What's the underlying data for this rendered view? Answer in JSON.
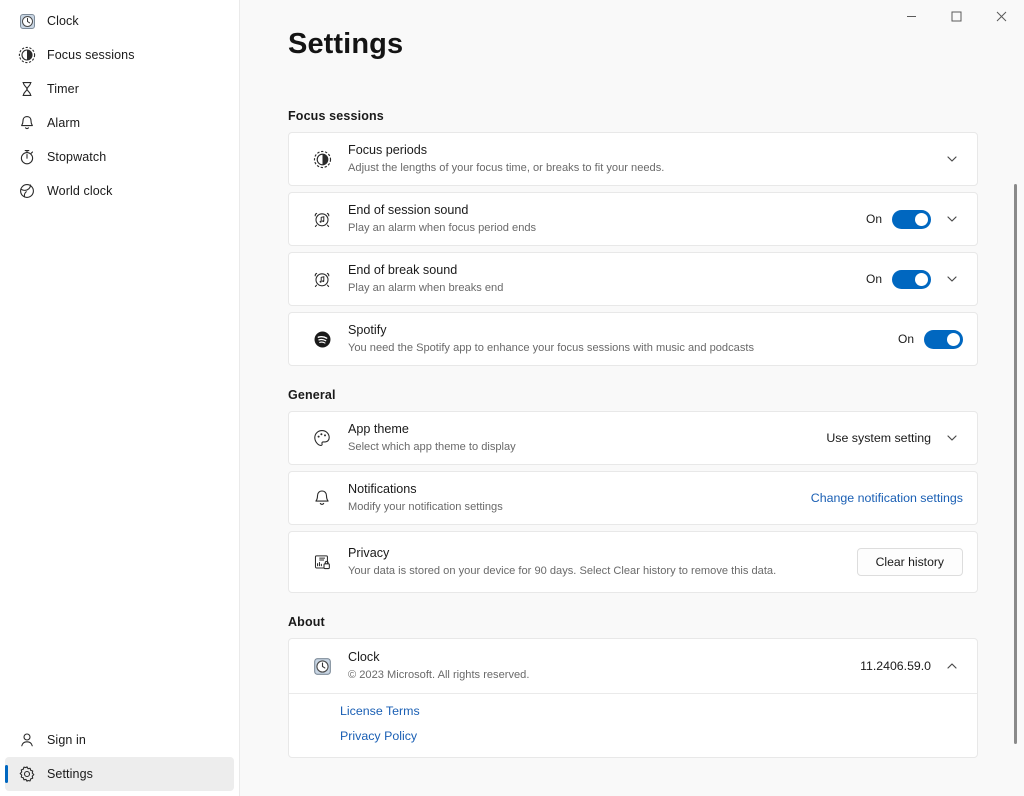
{
  "window": {
    "controls": [
      {
        "name": "minimize",
        "glyph": "minimize-icon"
      },
      {
        "name": "maximize",
        "glyph": "maximize-icon"
      },
      {
        "name": "close",
        "glyph": "close-icon"
      }
    ]
  },
  "sidebar": {
    "items": [
      {
        "label": "Clock",
        "icon": "clock-app-icon",
        "selected": false
      },
      {
        "label": "Focus sessions",
        "icon": "focus-sessions-icon",
        "selected": false
      },
      {
        "label": "Timer",
        "icon": "hourglass-icon",
        "selected": false
      },
      {
        "label": "Alarm",
        "icon": "bell-icon",
        "selected": false
      },
      {
        "label": "Stopwatch",
        "icon": "stopwatch-icon",
        "selected": false
      },
      {
        "label": "World clock",
        "icon": "globe-clock-icon",
        "selected": false
      }
    ],
    "bottom": [
      {
        "label": "Sign in",
        "icon": "person-icon",
        "selected": false
      },
      {
        "label": "Settings",
        "icon": "gear-icon",
        "selected": true
      }
    ]
  },
  "page": {
    "title": "Settings",
    "accent_color": "#0067C0",
    "link_color": "#1A5FB4"
  },
  "groups": {
    "focus_sessions": {
      "heading": "Focus sessions",
      "rows": [
        {
          "title": "Focus periods",
          "subtitle": "Adjust the lengths of your focus time, or breaks to fit your needs.",
          "icon": "focus-sessions-icon",
          "control": "chevron",
          "chevron": "down"
        },
        {
          "title": "End of session sound",
          "subtitle": "Play an alarm when focus period ends",
          "icon": "alarm-music-icon",
          "control": "toggle-chevron",
          "toggle_label": "On",
          "toggle_on": true,
          "chevron": "down"
        },
        {
          "title": "End of break sound",
          "subtitle": "Play an alarm when breaks end",
          "icon": "alarm-music-icon",
          "control": "toggle-chevron",
          "toggle_label": "On",
          "toggle_on": true,
          "chevron": "down"
        },
        {
          "title": "Spotify",
          "subtitle": "You need the Spotify app to enhance your focus sessions with music and podcasts",
          "icon": "spotify-icon",
          "control": "toggle",
          "toggle_label": "On",
          "toggle_on": true
        }
      ]
    },
    "general": {
      "heading": "General",
      "rows": [
        {
          "title": "App theme",
          "subtitle": "Select which app theme to display",
          "icon": "palette-icon",
          "control": "select",
          "value": "Use system setting",
          "chevron": "down"
        },
        {
          "title": "Notifications",
          "subtitle": "Modify your notification settings",
          "icon": "bell-icon",
          "control": "link",
          "link_text": "Change notification settings"
        },
        {
          "title": "Privacy",
          "subtitle": "Your data is stored on your device for 90 days. Select Clear history to remove this data.",
          "icon": "privacy-chart-lock-icon",
          "control": "button",
          "button_label": "Clear history"
        }
      ]
    },
    "about": {
      "heading": "About",
      "app_name": "Clock",
      "copyright": "© 2023 Microsoft. All rights reserved.",
      "icon": "clock-app-icon",
      "version": "11.2406.59.0",
      "chevron": "up",
      "links": [
        {
          "label": "License Terms"
        },
        {
          "label": "Privacy Policy"
        }
      ]
    }
  }
}
